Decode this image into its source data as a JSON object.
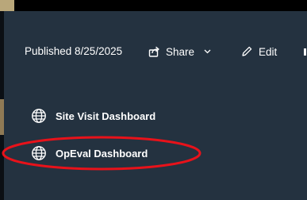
{
  "toolbar": {
    "published_text": "Published 8/25/2025",
    "share_label": "Share",
    "share_icon": "share-icon",
    "share_dropdown_icon": "chevron-down-icon",
    "edit_label": "Edit",
    "edit_icon": "pencil-icon"
  },
  "dashboards": [
    {
      "label": "Site Visit Dashboard",
      "icon": "globe-icon"
    },
    {
      "label": "OpEval Dashboard",
      "icon": "globe-icon",
      "highlighted": true
    }
  ],
  "colors": {
    "background": "#243240",
    "text": "#ffffff",
    "highlight_ellipse": "#e8121a"
  }
}
